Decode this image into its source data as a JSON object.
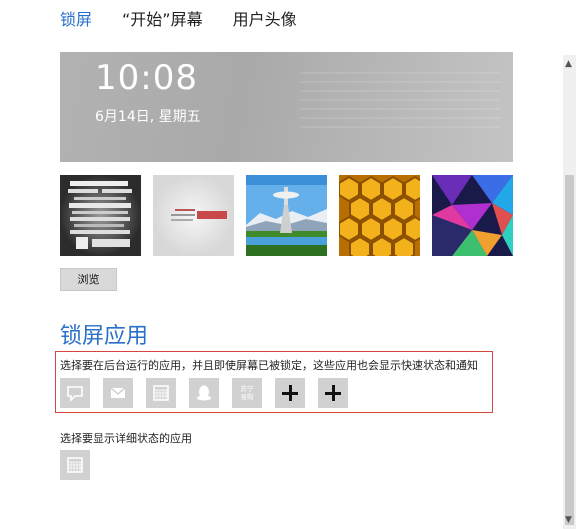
{
  "tabs": [
    {
      "label": "锁屏",
      "active": true
    },
    {
      "label": "“开始”屏幕",
      "active": false
    },
    {
      "label": "用户头像",
      "active": false
    }
  ],
  "preview": {
    "time": "10:08",
    "date": "6月14日, 星期五"
  },
  "thumbnails": [
    {
      "name": "typography-poster"
    },
    {
      "name": "future-today"
    },
    {
      "name": "space-needle"
    },
    {
      "name": "honeycomb"
    },
    {
      "name": "geometric-triangles"
    }
  ],
  "browse_label": "浏览",
  "section": {
    "title": "锁屏应用",
    "background_apps_desc": "选择要在后台运行的应用，并且即使屏幕已被锁定，这些应用也会显示快速状态和通知",
    "background_apps": [
      {
        "icon": "messaging-icon"
      },
      {
        "icon": "mail-icon"
      },
      {
        "icon": "calendar-icon"
      },
      {
        "icon": "qq-penguin-icon"
      },
      {
        "icon": "suning-app-icon",
        "label": "苏宁\n易购"
      },
      {
        "icon": "plus-icon"
      },
      {
        "icon": "plus-icon"
      }
    ],
    "detailed_status_desc": "选择要显示详细状态的应用",
    "detailed_status_app": {
      "icon": "calendar-icon"
    }
  },
  "colors": {
    "accent": "#2a6fc9",
    "highlight_box": "#d6463e",
    "app_tile": "#d1d1d1"
  }
}
